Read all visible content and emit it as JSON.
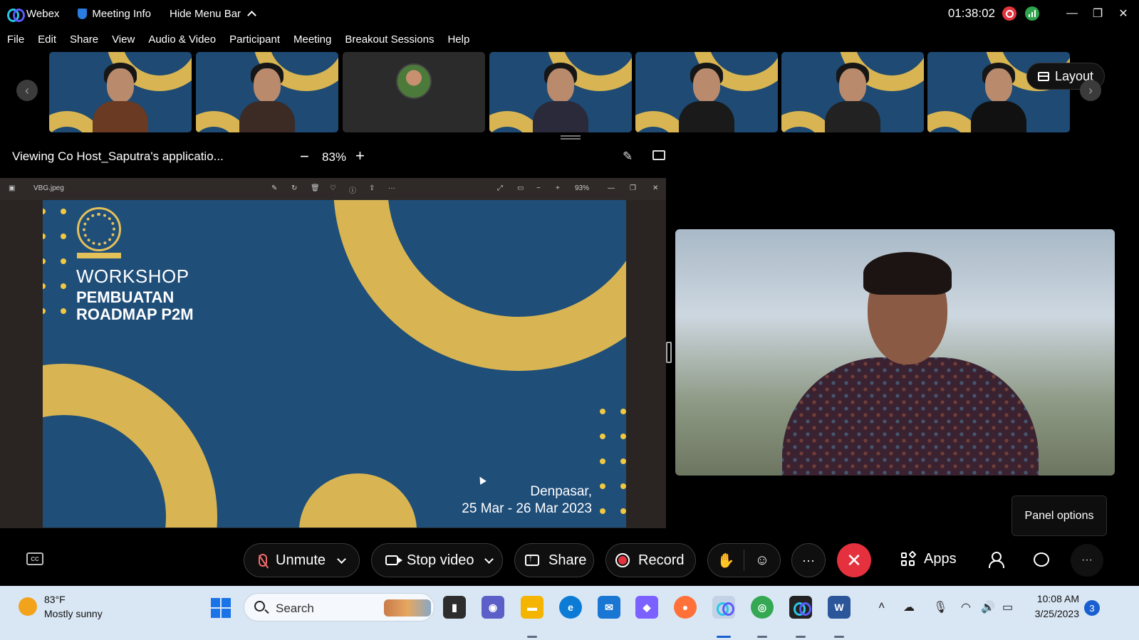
{
  "titlebar": {
    "app_name": "Webex",
    "meeting_info": "Meeting Info",
    "hide_menu": "Hide Menu Bar",
    "timer": "01:38:02"
  },
  "menu": [
    "File",
    "Edit",
    "Share",
    "View",
    "Audio & Video",
    "Participant",
    "Meeting",
    "Breakout Sessions",
    "Help"
  ],
  "thumbnails": {
    "layout_label": "Layout"
  },
  "viewing": {
    "title": "Viewing Co Host_Saputra's applicatio...",
    "zoom": "83%",
    "minus": "−",
    "plus": "+"
  },
  "shared_window": {
    "filename": "VBG.jpeg",
    "zoom": "93%"
  },
  "slide": {
    "line1": "WORKSHOP",
    "line2": "PEMBUATAN",
    "line3": "ROADMAP P2M",
    "location": "Denpasar,",
    "dates": "25 Mar - 26 Mar 2023"
  },
  "panel_options": "Panel options",
  "controls": {
    "unmute": "Unmute",
    "stop_video": "Stop video",
    "share": "Share",
    "record": "Record",
    "apps": "Apps",
    "more": "···",
    "menu_more": "···"
  },
  "taskbar": {
    "temperature": "83°F",
    "condition": "Mostly sunny",
    "search_placeholder": "Search",
    "time": "10:08 AM",
    "date": "3/25/2023",
    "notifications": "3"
  },
  "colors": {
    "slide_bg": "#1f4e79",
    "slide_accent": "#d8b552",
    "end_call": "#e5313d",
    "record_red": "#e2343f"
  }
}
